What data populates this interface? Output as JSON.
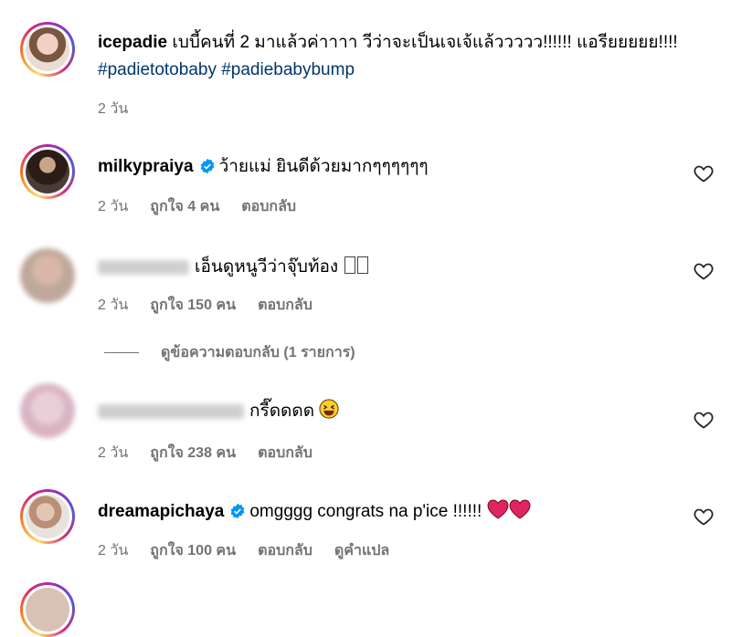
{
  "post": {
    "username": "icepadie",
    "caption": "เบบี้คนที่ 2 มาแล้วค่าาาา วีว่าจะเป็นเจเจ้แล้ววววว!!!!!! แอรียยยยย!!!!",
    "hashtags": [
      "#padietotobaby",
      "#padiebabybump"
    ],
    "time": "2 วัน"
  },
  "comments": [
    {
      "username": "milkypraiya",
      "verified": true,
      "text": "ว้ายแม่ ยินดีด้วยมากๆๆๆๆๆๆ",
      "time": "2 วัน",
      "likes": "ถูกใจ 4 คน",
      "reply": "ตอบกลับ"
    },
    {
      "username": "",
      "text": "เอ็นดูหนูวีว่าจุ๊บท้อง",
      "time": "2 วัน",
      "likes": "ถูกใจ 150 คน",
      "reply": "ตอบกลับ",
      "view_replies": "ดูข้อความตอบกลับ (1 รายการ)"
    },
    {
      "username": "",
      "text": "กรี๊ดดดด",
      "time": "2 วัน",
      "likes": "ถูกใจ 238 คน",
      "reply": "ตอบกลับ"
    },
    {
      "username": "dreamapichaya",
      "verified": true,
      "text": "omgggg congrats na p'ice !!!!!!",
      "time": "2 วัน",
      "likes": "ถูกใจ 100 คน",
      "reply": "ตอบกลับ",
      "translate": "ดูคำแปล"
    }
  ],
  "colors": {
    "hashtag": "#00376b",
    "verified": "#0095f6",
    "muted": "#737373",
    "heart_emoji": "#e0245e"
  },
  "icons": [
    "verified-badge-icon",
    "heart-outline-icon",
    "grinning-squint-emoji",
    "red-heart-emoji"
  ]
}
